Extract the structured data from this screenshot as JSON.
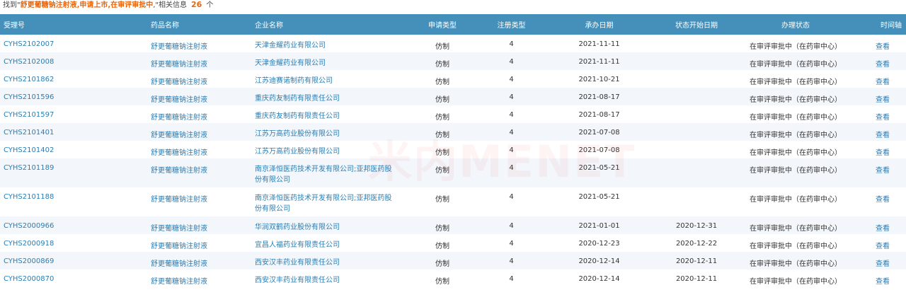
{
  "summary": {
    "prefix": "找到\"",
    "query": "舒更葡糖钠注射液,申请上市,在审评审批中",
    "suffix": ",\"相关信息",
    "count": "26",
    "unit": "个"
  },
  "table": {
    "headers": [
      "受理号",
      "药品名称",
      "企业名称",
      "申请类型",
      "注册类型",
      "承办日期",
      "状态开始日期",
      "办理状态",
      "时间轴"
    ],
    "rows": [
      {
        "id": "CYHS2102007",
        "drug": "舒更葡糖钠注射液",
        "company": "天津金耀药业有限公司",
        "apply_type": "仿制",
        "reg_type": "4",
        "date": "2021-11-11",
        "status_start": "",
        "status": "在审评审批中（在药审中心）",
        "timeline": "查看"
      },
      {
        "id": "CYHS2102008",
        "drug": "舒更葡糖钠注射液",
        "company": "天津金耀药业有限公司",
        "apply_type": "仿制",
        "reg_type": "4",
        "date": "2021-11-11",
        "status_start": "",
        "status": "在审评审批中（在药审中心）",
        "timeline": "查看"
      },
      {
        "id": "CYHS2101862",
        "drug": "舒更葡糖钠注射液",
        "company": "江苏迪赛诺制药有限公司",
        "apply_type": "仿制",
        "reg_type": "4",
        "date": "2021-10-21",
        "status_start": "",
        "status": "在审评审批中（在药审中心）",
        "timeline": "查看"
      },
      {
        "id": "CYHS2101596",
        "drug": "舒更葡糖钠注射液",
        "company": "重庆药友制药有限责任公司",
        "apply_type": "仿制",
        "reg_type": "4",
        "date": "2021-08-17",
        "status_start": "",
        "status": "在审评审批中（在药审中心）",
        "timeline": "查看"
      },
      {
        "id": "CYHS2101597",
        "drug": "舒更葡糖钠注射液",
        "company": "重庆药友制药有限责任公司",
        "apply_type": "仿制",
        "reg_type": "4",
        "date": "2021-08-17",
        "status_start": "",
        "status": "在审评审批中（在药审中心）",
        "timeline": "查看"
      },
      {
        "id": "CYHS2101401",
        "drug": "舒更葡糖钠注射液",
        "company": "江苏万高药业股份有限公司",
        "apply_type": "仿制",
        "reg_type": "4",
        "date": "2021-07-08",
        "status_start": "",
        "status": "在审评审批中（在药审中心）",
        "timeline": "查看"
      },
      {
        "id": "CYHS2101402",
        "drug": "舒更葡糖钠注射液",
        "company": "江苏万高药业股份有限公司",
        "apply_type": "仿制",
        "reg_type": "4",
        "date": "2021-07-08",
        "status_start": "",
        "status": "在审评审批中（在药审中心）",
        "timeline": "查看"
      },
      {
        "id": "CYHS2101189",
        "drug": "舒更葡糖钠注射液",
        "company": "南京泽恒医药技术开发有限公司;亚邦医药股份有限公司",
        "apply_type": "仿制",
        "reg_type": "4",
        "date": "2021-05-21",
        "status_start": "",
        "status": "在审评审批中（在药审中心）",
        "timeline": "查看"
      },
      {
        "id": "CYHS2101188",
        "drug": "舒更葡糖钠注射液",
        "company": "南京泽恒医药技术开发有限公司;亚邦医药股份有限公司",
        "apply_type": "仿制",
        "reg_type": "4",
        "date": "2021-05-21",
        "status_start": "",
        "status": "在审评审批中（在药审中心）",
        "timeline": "查看"
      },
      {
        "id": "CYHS2000966",
        "drug": "舒更葡糖钠注射液",
        "company": "华润双鹤药业股份有限公司",
        "apply_type": "仿制",
        "reg_type": "4",
        "date": "2021-01-01",
        "status_start": "2020-12-31",
        "status": "在审评审批中（在药审中心）",
        "timeline": "查看"
      },
      {
        "id": "CYHS2000918",
        "drug": "舒更葡糖钠注射液",
        "company": "宜昌人福药业有限责任公司",
        "apply_type": "仿制",
        "reg_type": "4",
        "date": "2020-12-23",
        "status_start": "2020-12-22",
        "status": "在审评审批中（在药审中心）",
        "timeline": "查看"
      },
      {
        "id": "CYHS2000869",
        "drug": "舒更葡糖钠注射液",
        "company": "西安汉丰药业有限责任公司",
        "apply_type": "仿制",
        "reg_type": "4",
        "date": "2020-12-14",
        "status_start": "2020-12-11",
        "status": "在审评审批中（在药审中心）",
        "timeline": "查看"
      },
      {
        "id": "CYHS2000870",
        "drug": "舒更葡糖钠注射液",
        "company": "西安汉丰药业有限责任公司",
        "apply_type": "仿制",
        "reg_type": "4",
        "date": "2020-12-14",
        "status_start": "2020-12-11",
        "status": "在审评审批中（在药审中心）",
        "timeline": "查看"
      }
    ]
  },
  "watermark": "米内MENET",
  "colors": {
    "header_bg": "#4590ba",
    "link": "#2a7db3",
    "highlight": "#e8670c",
    "stripe": "#f3f7fb"
  }
}
